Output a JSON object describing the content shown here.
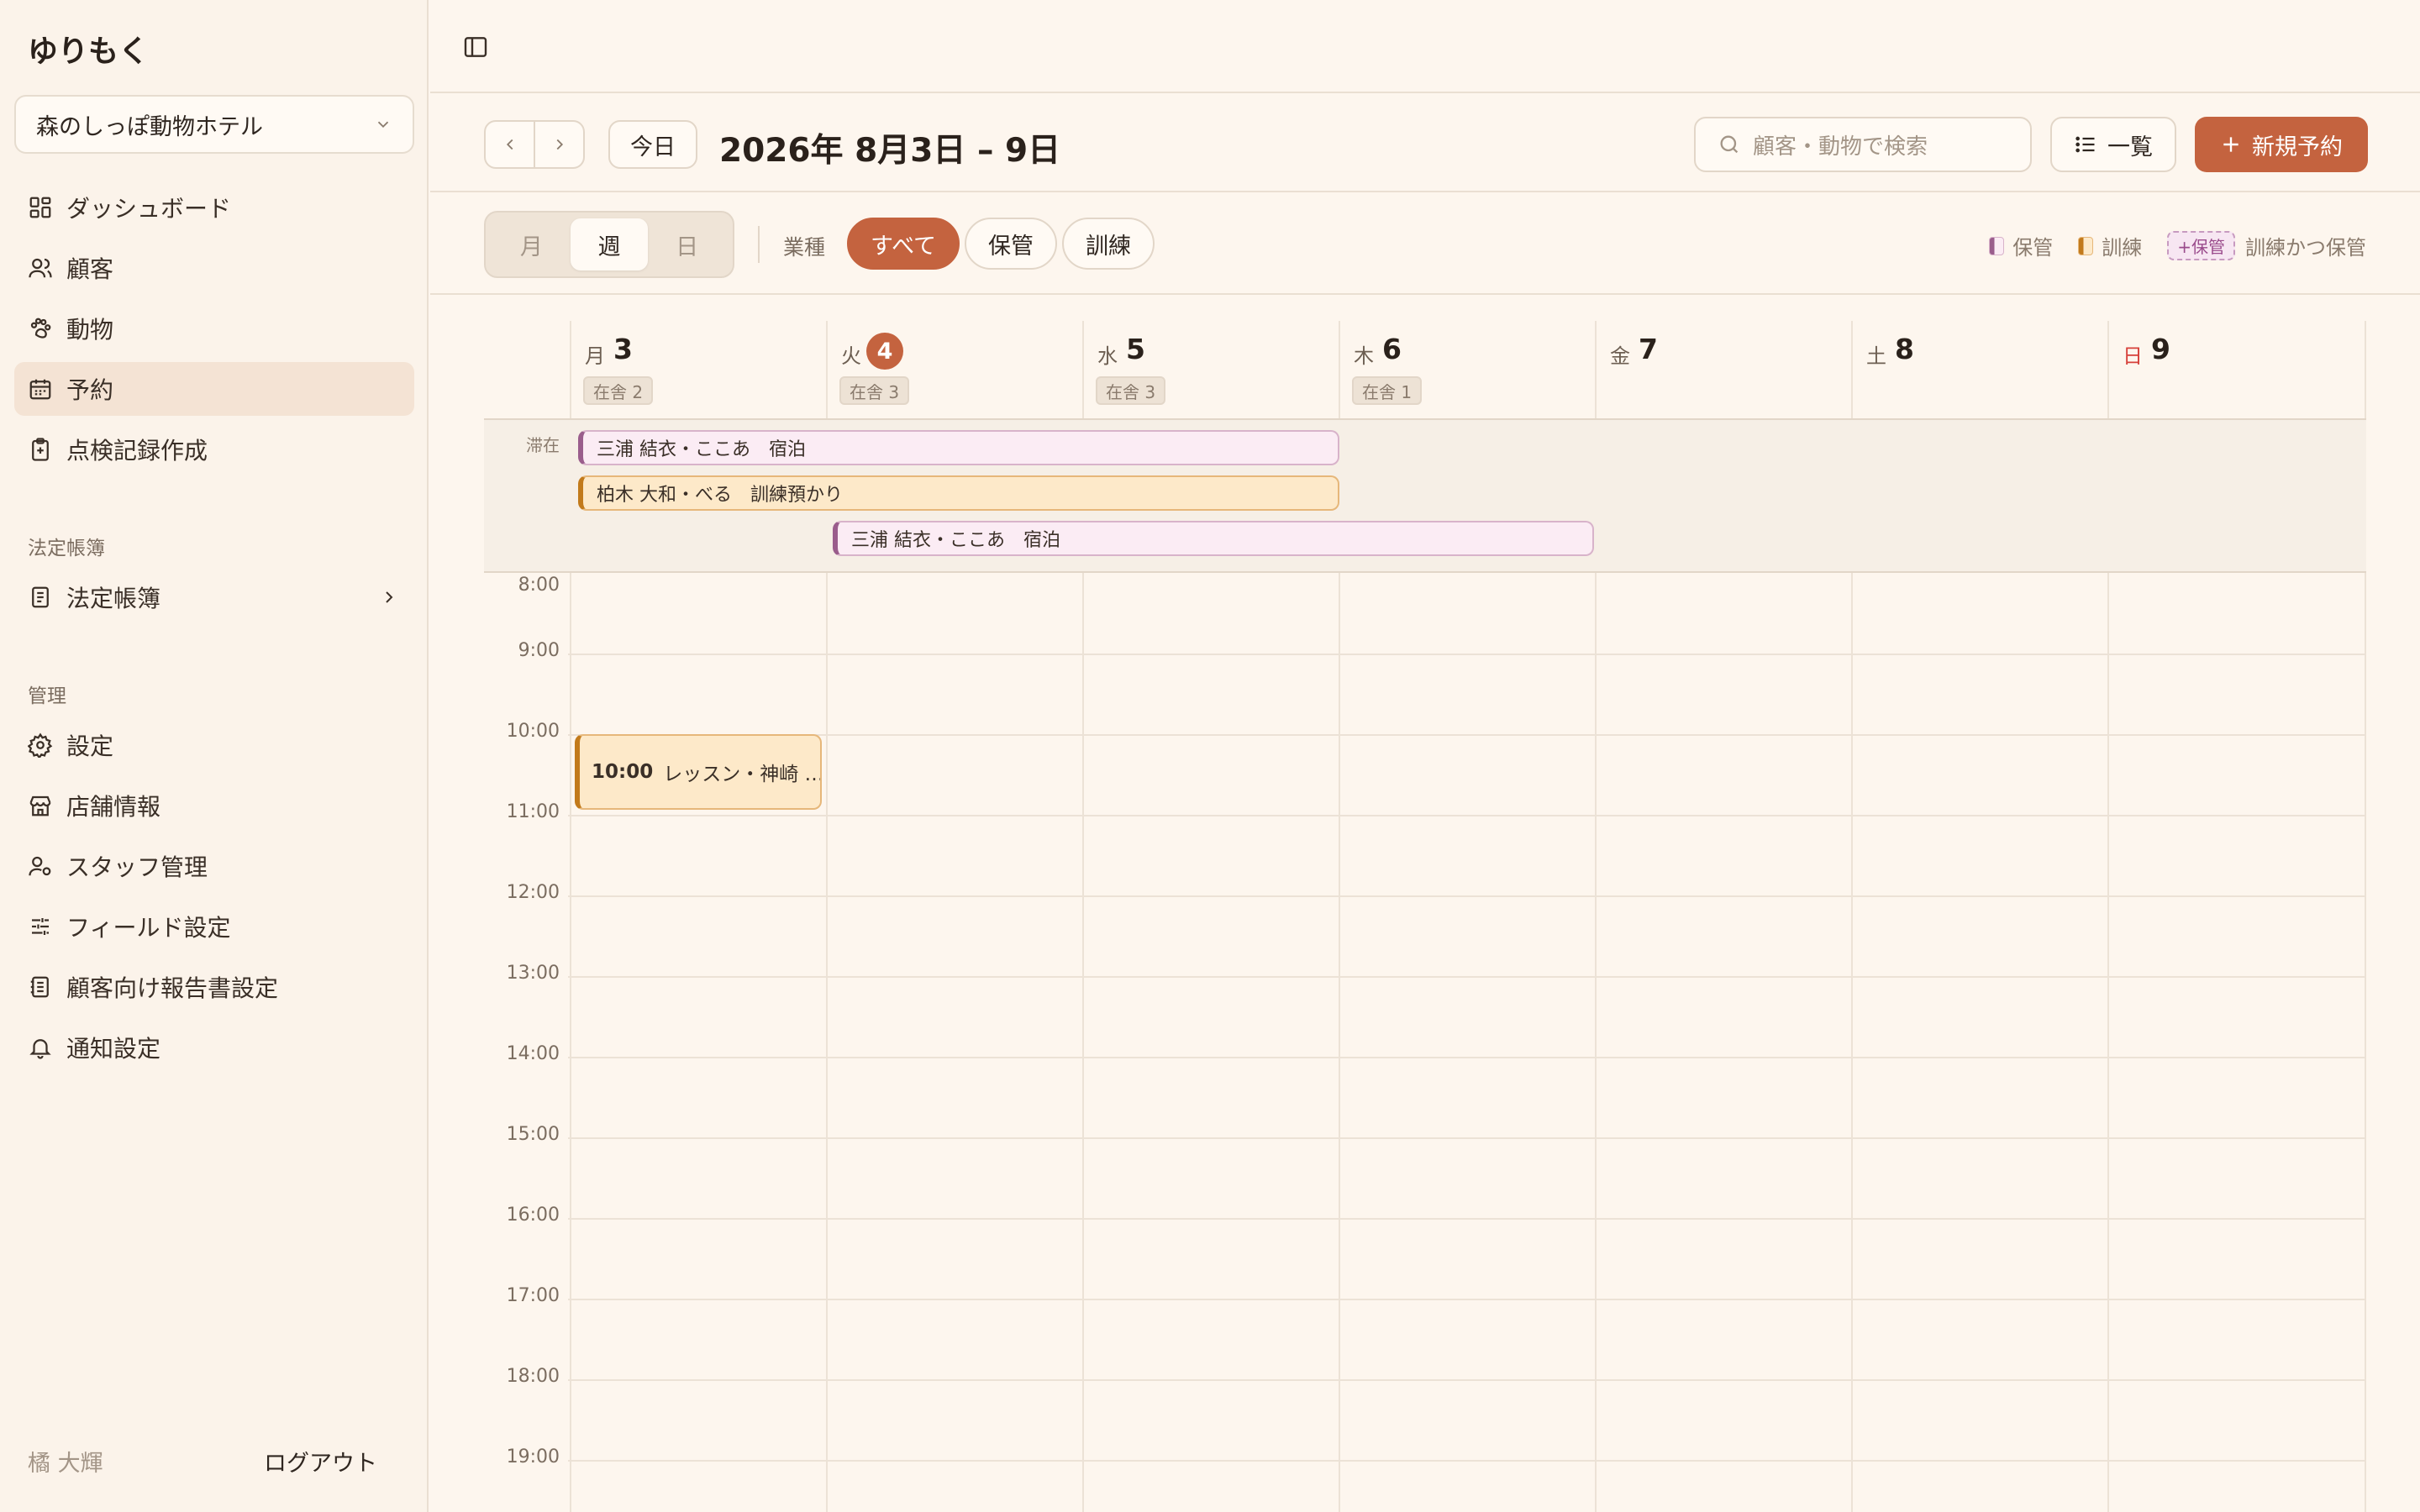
{
  "app": {
    "brand": "ゆりもく"
  },
  "store": {
    "selected": "森のしっぽ動物ホテル"
  },
  "sidebar": {
    "main_items": [
      {
        "label": "ダッシュボード",
        "icon": "grid-icon"
      },
      {
        "label": "顧客",
        "icon": "users-icon"
      },
      {
        "label": "動物",
        "icon": "paw-icon"
      },
      {
        "label": "予約",
        "icon": "calendar-icon",
        "active": true
      },
      {
        "label": "点検記録作成",
        "icon": "clipboard-icon"
      }
    ],
    "section_ledger": "法定帳簿",
    "ledger_item": "法定帳簿",
    "section_admin": "管理",
    "admin_items": [
      {
        "label": "設定",
        "icon": "gear-icon"
      },
      {
        "label": "店舗情報",
        "icon": "store-icon"
      },
      {
        "label": "スタッフ管理",
        "icon": "user-cog-icon"
      },
      {
        "label": "フィールド設定",
        "icon": "sliders-icon"
      },
      {
        "label": "顧客向け報告書設定",
        "icon": "report-icon"
      },
      {
        "label": "通知設定",
        "icon": "bell-icon"
      }
    ],
    "user": "橘 大輝",
    "logout": "ログアウト"
  },
  "toolbar": {
    "today": "今日",
    "range": "2026年 8月3日 – 9日",
    "search_placeholder": "顧客・動物で検索",
    "list": "一覧",
    "new": "新規予約"
  },
  "filters": {
    "views": [
      "月",
      "週",
      "日"
    ],
    "active_view": "週",
    "category_label": "業種",
    "chips": [
      "すべて",
      "保管",
      "訓練"
    ],
    "active_chip": "すべて"
  },
  "legend": {
    "care": "保管",
    "train": "訓練",
    "combo_tag": "+保管",
    "combo": "訓練かつ保管"
  },
  "colors": {
    "accent": "#c4633f",
    "care": "#9a5d8c",
    "train": "#c27a1b",
    "sunday": "#d6403a"
  },
  "calendar": {
    "days": [
      {
        "dow": "月",
        "num": "3",
        "occ": "在舎 2"
      },
      {
        "dow": "火",
        "num": "4",
        "occ": "在舎 3",
        "today": true
      },
      {
        "dow": "水",
        "num": "5",
        "occ": "在舎 3"
      },
      {
        "dow": "木",
        "num": "6",
        "occ": "在舎 1"
      },
      {
        "dow": "金",
        "num": "7",
        "occ": ""
      },
      {
        "dow": "土",
        "num": "8",
        "occ": ""
      },
      {
        "dow": "日",
        "num": "9",
        "occ": "",
        "sunday": true
      }
    ],
    "stay_label": "滞在",
    "stays": [
      {
        "text": "三浦 結衣・ここあ　宿泊",
        "kind": "care"
      },
      {
        "text": "柏木 大和・べる　訓練預かり",
        "kind": "train"
      },
      {
        "text": "三浦 結衣・ここあ　宿泊",
        "kind": "care"
      }
    ],
    "hours": [
      "8:00",
      "9:00",
      "10:00",
      "11:00",
      "12:00",
      "13:00",
      "14:00",
      "15:00",
      "16:00",
      "17:00",
      "18:00",
      "19:00"
    ],
    "event": {
      "time": "10:00",
      "title": "レッスン・神崎 …"
    }
  }
}
